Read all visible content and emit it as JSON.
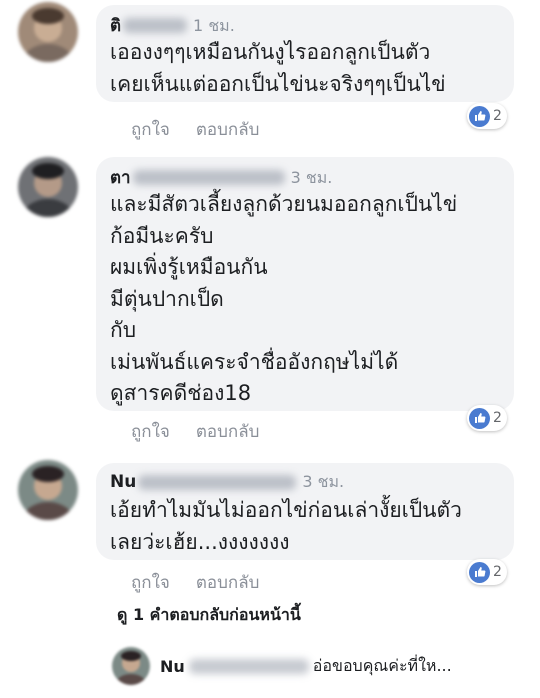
{
  "colors": {
    "bubble_bg": "#f2f3f5",
    "like_blue": "#4a7bd0",
    "muted_text": "#8d949e"
  },
  "comments": [
    {
      "author": "ติ",
      "time": "1 ชม.",
      "lines": [
        "เอองงๆๆเหมือนกันงูไรออกลูกเป็นตัว",
        "เคยเห็นแต่ออกเป็นไข่นะจริงๆๆเป็นไข่"
      ],
      "like_label": "ถูกใจ",
      "reply_label": "ตอบกลับ",
      "reaction_icon": "like-icon",
      "reaction_count": "2"
    },
    {
      "author": "ตา",
      "time": "3 ชม.",
      "lines": [
        "และมีสัตวเลี้ยงลูกด้วยนมออกลูกเป็นไข่",
        "ก้อมีนะครับ",
        "ผมเพิ่งรู้เหมือนกัน",
        "มีตุ่นปากเป็ด",
        "กับ",
        "เม่นพันธ์แคระจำชื่ออังกฤษไม่ได้",
        "ดูสารคดีช่อง18"
      ],
      "like_label": "ถูกใจ",
      "reply_label": "ตอบกลับ",
      "reaction_icon": "like-icon",
      "reaction_count": "2"
    },
    {
      "author": "Nu",
      "time": "3 ชม.",
      "lines": [
        "เอ้ยทำไมมันไม่ออกไข่ก่อนเล่างั้ยเป็นตัว",
        "เลยว่ะเฮ้ย...งงงงงงง"
      ],
      "like_label": "ถูกใจ",
      "reply_label": "ตอบกลับ",
      "reaction_icon": "like-icon",
      "reaction_count": "2"
    }
  ],
  "view_previous": "ดู 1 คำตอบกลับก่อนหน้านี้",
  "reply_preview": {
    "author": "Nu",
    "snippet": "อ่อขอบคุณค่ะที่ให..."
  }
}
